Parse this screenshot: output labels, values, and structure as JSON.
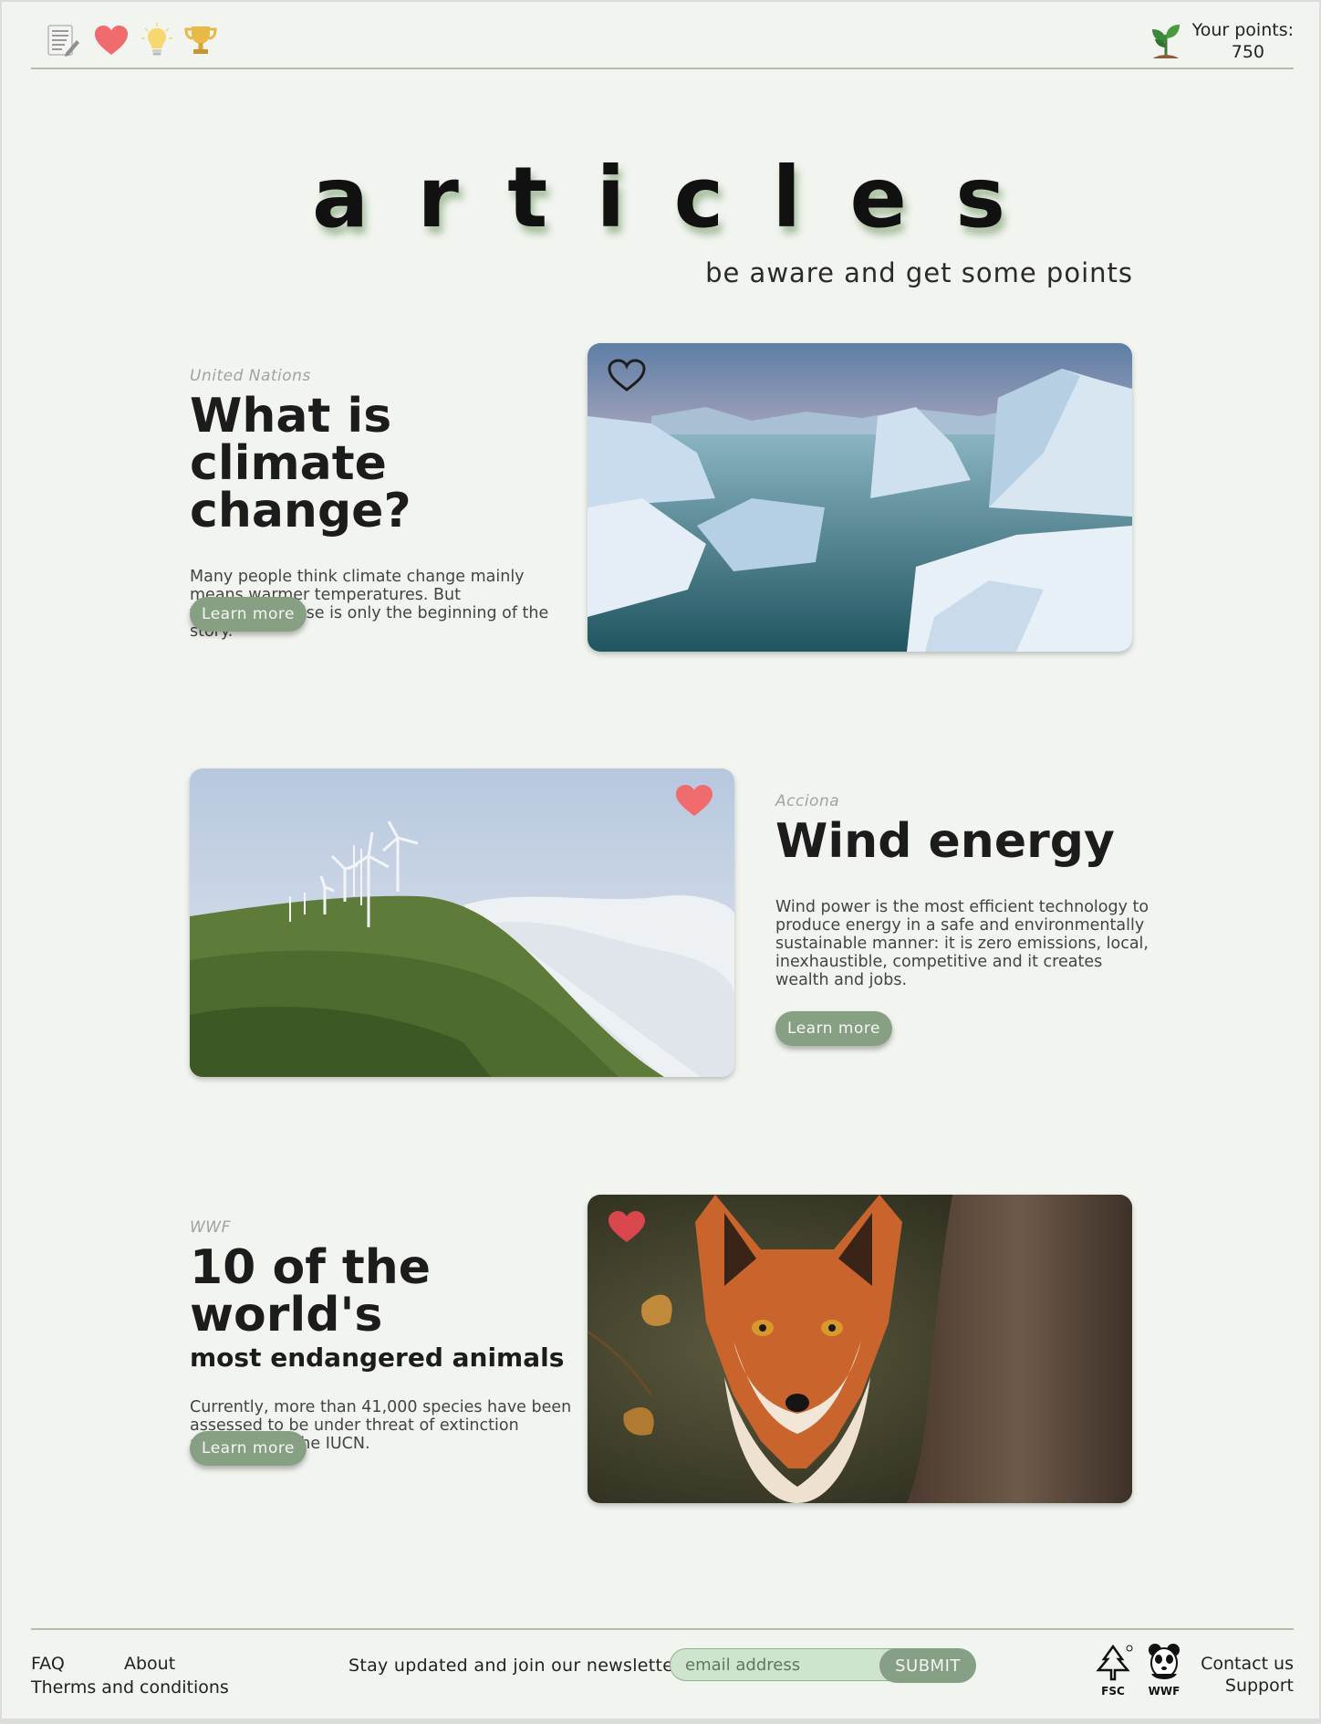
{
  "header": {
    "nav_icons": [
      "notes-icon",
      "heart-icon",
      "lightbulb-icon",
      "trophy-icon"
    ],
    "points_label": "Your points:",
    "points_value": "750"
  },
  "hero": {
    "title_letters": [
      "a",
      "r",
      "t",
      "i",
      "c",
      "l",
      "e",
      "s"
    ],
    "subtitle": "be aware and get some points"
  },
  "articles": [
    {
      "source": "United Nations",
      "title": "What is climate change?",
      "description": "Many people think climate change mainly means warmer temperatures. But temperature rise is only the beginning of the story.",
      "button": "Learn more",
      "favorited": false,
      "image": "icebergs"
    },
    {
      "source": "Acciona",
      "title": "Wind energy",
      "description": "Wind power is the most efficient technology to produce energy in a safe and environmentally sustainable manner: it is zero emissions, local, inexhaustible, competitive and it creates wealth and jobs.",
      "button": "Learn more",
      "favorited": true,
      "image": "wind turbines"
    },
    {
      "source": "WWF",
      "title": "10 of the world's",
      "subtitle": "most endangered animals",
      "description": "Currently, more than 41,000 species have been assessed to be under threat of extinction according to the IUCN.",
      "button": "Learn more",
      "favorited": true,
      "image": "fox"
    }
  ],
  "footer": {
    "faq": "FAQ",
    "about": "About",
    "terms": "Therms and conditions",
    "newsletter_label": "Stay updated and join our newsletter:",
    "email_placeholder": "email address",
    "submit": "SUBMIT",
    "fsc_label": "FSC",
    "wwf_label": "WWF",
    "contact": "Contact us",
    "support": "Support"
  },
  "colors": {
    "background": "#f1f4ef",
    "accent_green": "#87a083",
    "heart_red": "#ef6b6e",
    "divider": "#b2c0ab"
  }
}
